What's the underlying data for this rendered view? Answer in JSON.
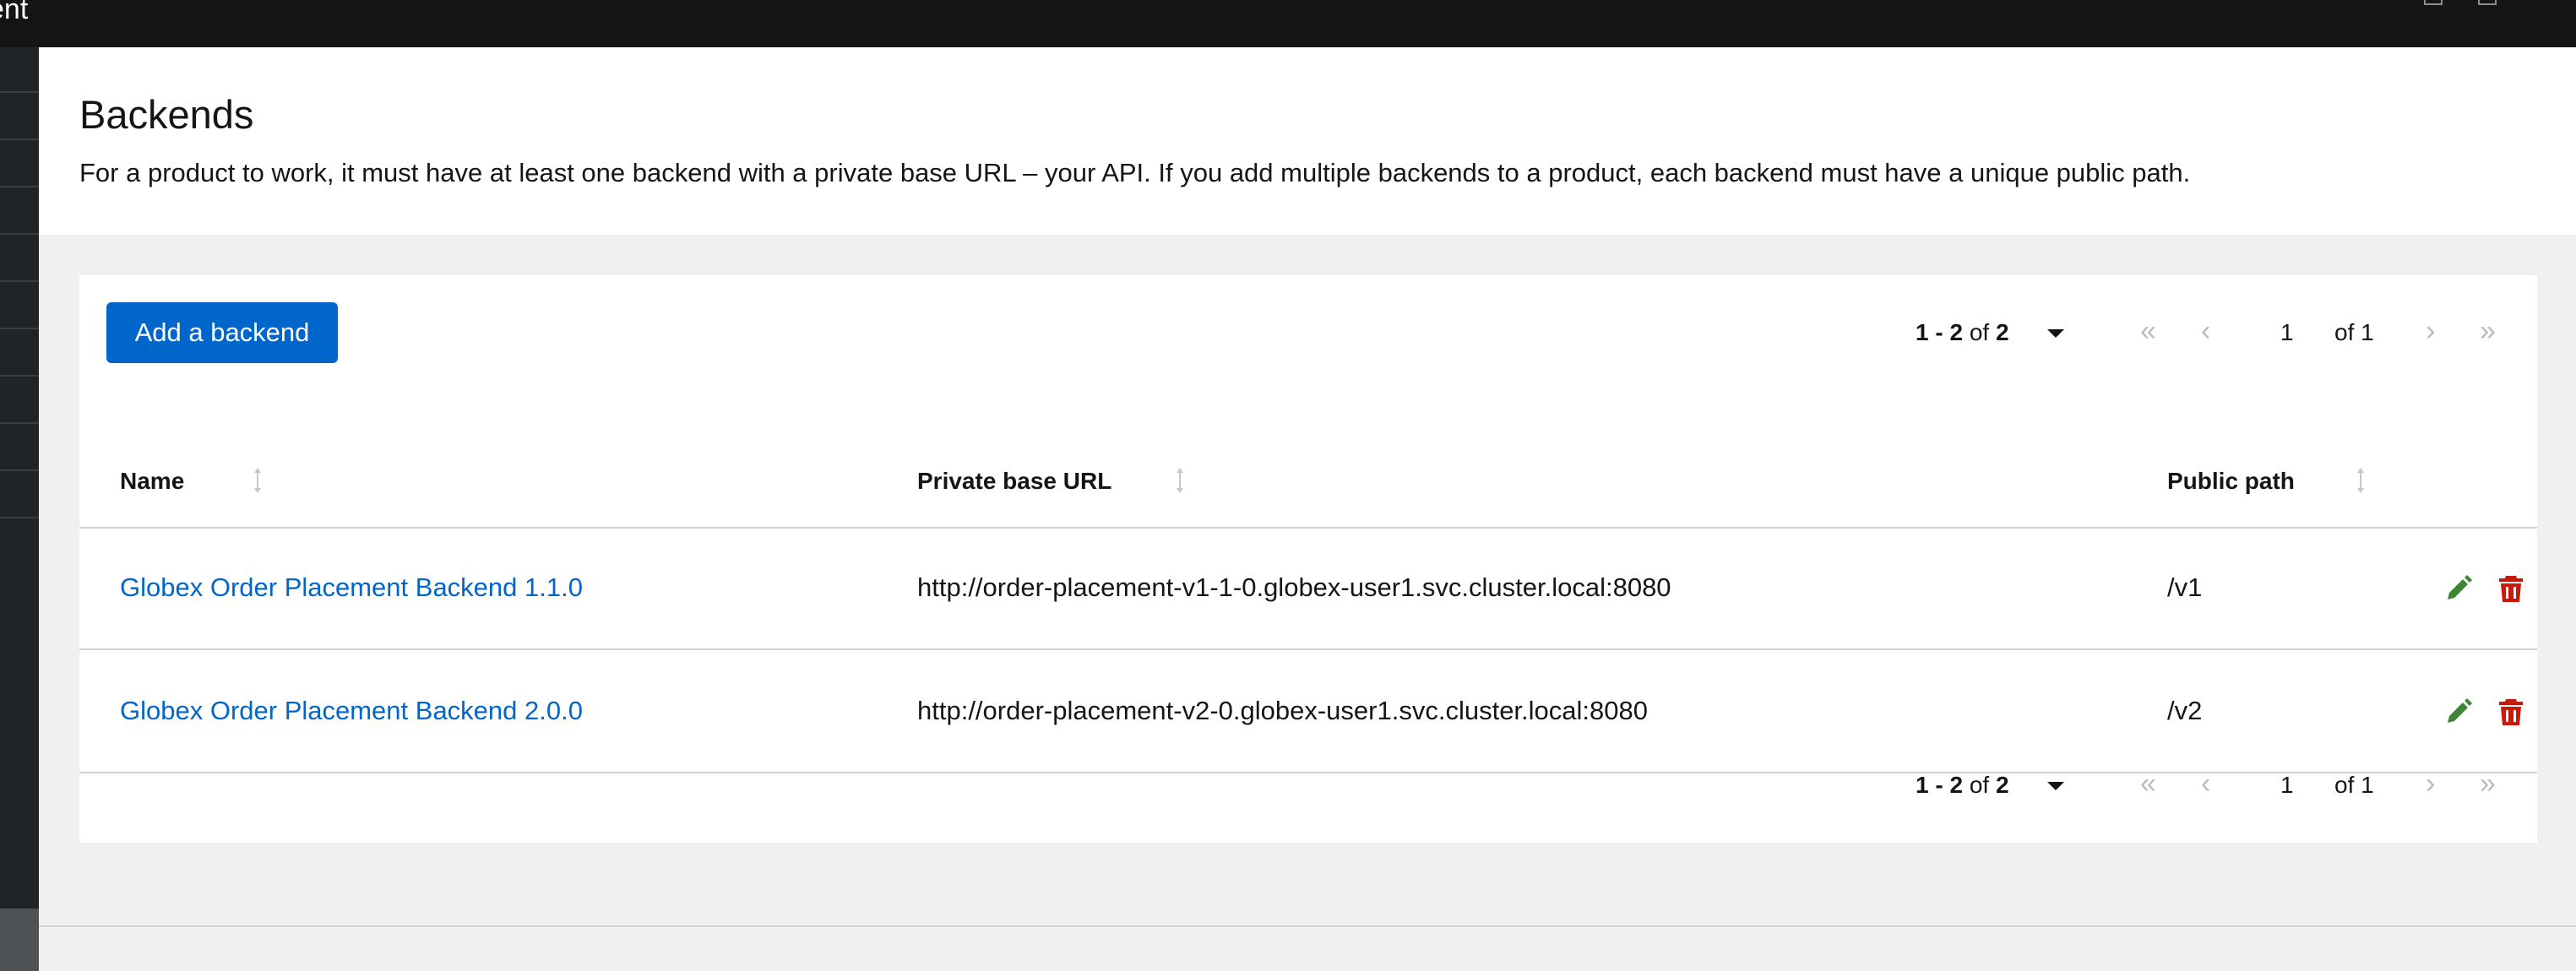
{
  "topbar": {
    "title": "ent"
  },
  "header": {
    "title": "Backends",
    "description": "For a product to work, it must have at least one backend with a private base URL – your API. If you add multiple backends to a product, each backend must have a unique public path."
  },
  "toolbar": {
    "add_label": "Add a backend"
  },
  "pagination": {
    "range": "1 - 2",
    "of_label": "of",
    "total": "2",
    "page": "1",
    "of_pages": "of 1",
    "first_icon": "«",
    "prev_icon": "‹",
    "next_icon": "›",
    "last_icon": "»"
  },
  "table": {
    "columns": [
      "Name",
      "Private base URL",
      "Public path"
    ],
    "rows": [
      {
        "name": "Globex Order Placement Backend 1.1.0",
        "url": "http://order-placement-v1-1-0.globex-user1.svc.cluster.local:8080",
        "path": "/v1"
      },
      {
        "name": "Globex Order Placement Backend 2.0.0",
        "url": "http://order-placement-v2-0.globex-user1.svc.cluster.local:8080",
        "path": "/v2"
      }
    ]
  },
  "colors": {
    "primary": "#0066cc",
    "edit": "#3e8635",
    "delete": "#c9190b",
    "topbar": "#151515"
  }
}
